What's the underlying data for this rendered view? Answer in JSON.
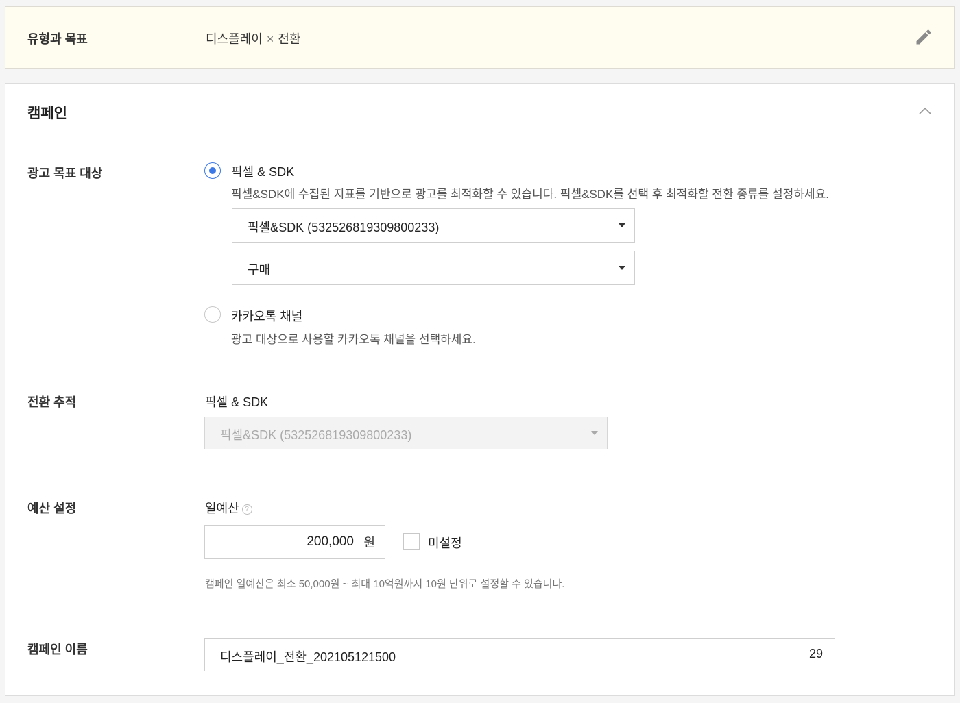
{
  "type_goal": {
    "label": "유형과 목표",
    "type": "디스플레이",
    "separator": "×",
    "goal": "전환"
  },
  "campaign": {
    "title": "캠페인",
    "ad_target": {
      "label": "광고 목표 대상",
      "options": [
        {
          "title": "픽셀 & SDK",
          "description": "픽셀&SDK에 수집된 지표를 기반으로 광고를 최적화할 수 있습니다. 픽셀&SDK를 선택 후 최적화할 전환 종류를 설정하세요.",
          "selected": true
        },
        {
          "title": "카카오톡 채널",
          "description": "광고 대상으로 사용할 카카오톡 채널을 선택하세요.",
          "selected": false
        }
      ],
      "pixel_select": "픽셀&SDK (532526819309800233)",
      "event_select": "구매"
    },
    "conversion_tracking": {
      "label": "전환 추적",
      "sublabel": "픽셀 & SDK",
      "select_value": "픽셀&SDK (532526819309800233)"
    },
    "budget": {
      "label": "예산 설정",
      "sublabel": "일예산",
      "help_glyph": "?",
      "amount": "200,000",
      "unit": "원",
      "unset_label": "미설정",
      "unset_checked": false,
      "note": "캠페인 일예산은 최소 50,000원 ~ 최대 10억원까지 10원 단위로 설정할 수 있습니다."
    },
    "name": {
      "label": "캠페인 이름",
      "value": "디스플레이_전환_202105121500",
      "remaining": "29"
    }
  },
  "icons": {
    "edit": "pencil-icon",
    "collapse": "chevron-up-icon",
    "dropdown": "caret-down-icon"
  },
  "colors": {
    "accent": "#3c78e6",
    "type_box_bg": "#fffcf0"
  }
}
